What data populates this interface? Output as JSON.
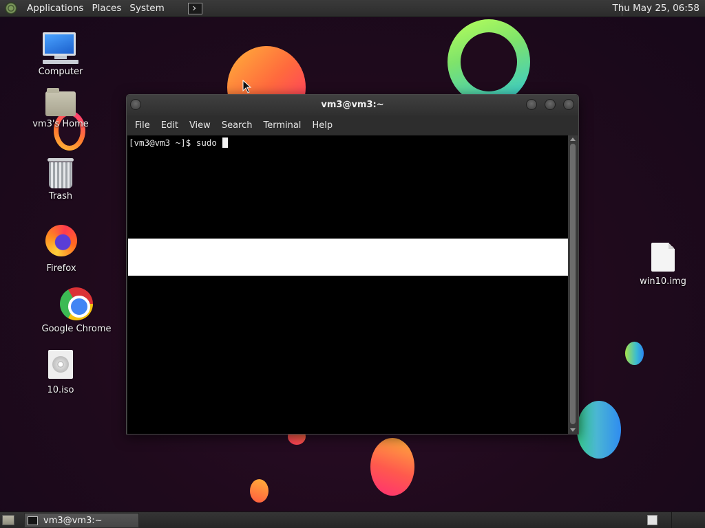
{
  "top_panel": {
    "menus": [
      "Applications",
      "Places",
      "System"
    ],
    "clock": "Thu May 25, 06:58"
  },
  "desktop_icons": {
    "computer": "Computer",
    "home": "vm3's Home",
    "trash": "Trash",
    "firefox": "Firefox",
    "chrome": "Google Chrome",
    "iso": "10.iso",
    "img": "win10.img"
  },
  "terminal": {
    "title": "vm3@vm3:~",
    "menu": [
      "File",
      "Edit",
      "View",
      "Search",
      "Terminal",
      "Help"
    ],
    "prompt_line": "[vm3@vm3 ~]$ sudo "
  },
  "bottom_panel": {
    "task_label": "vm3@vm3:~"
  }
}
